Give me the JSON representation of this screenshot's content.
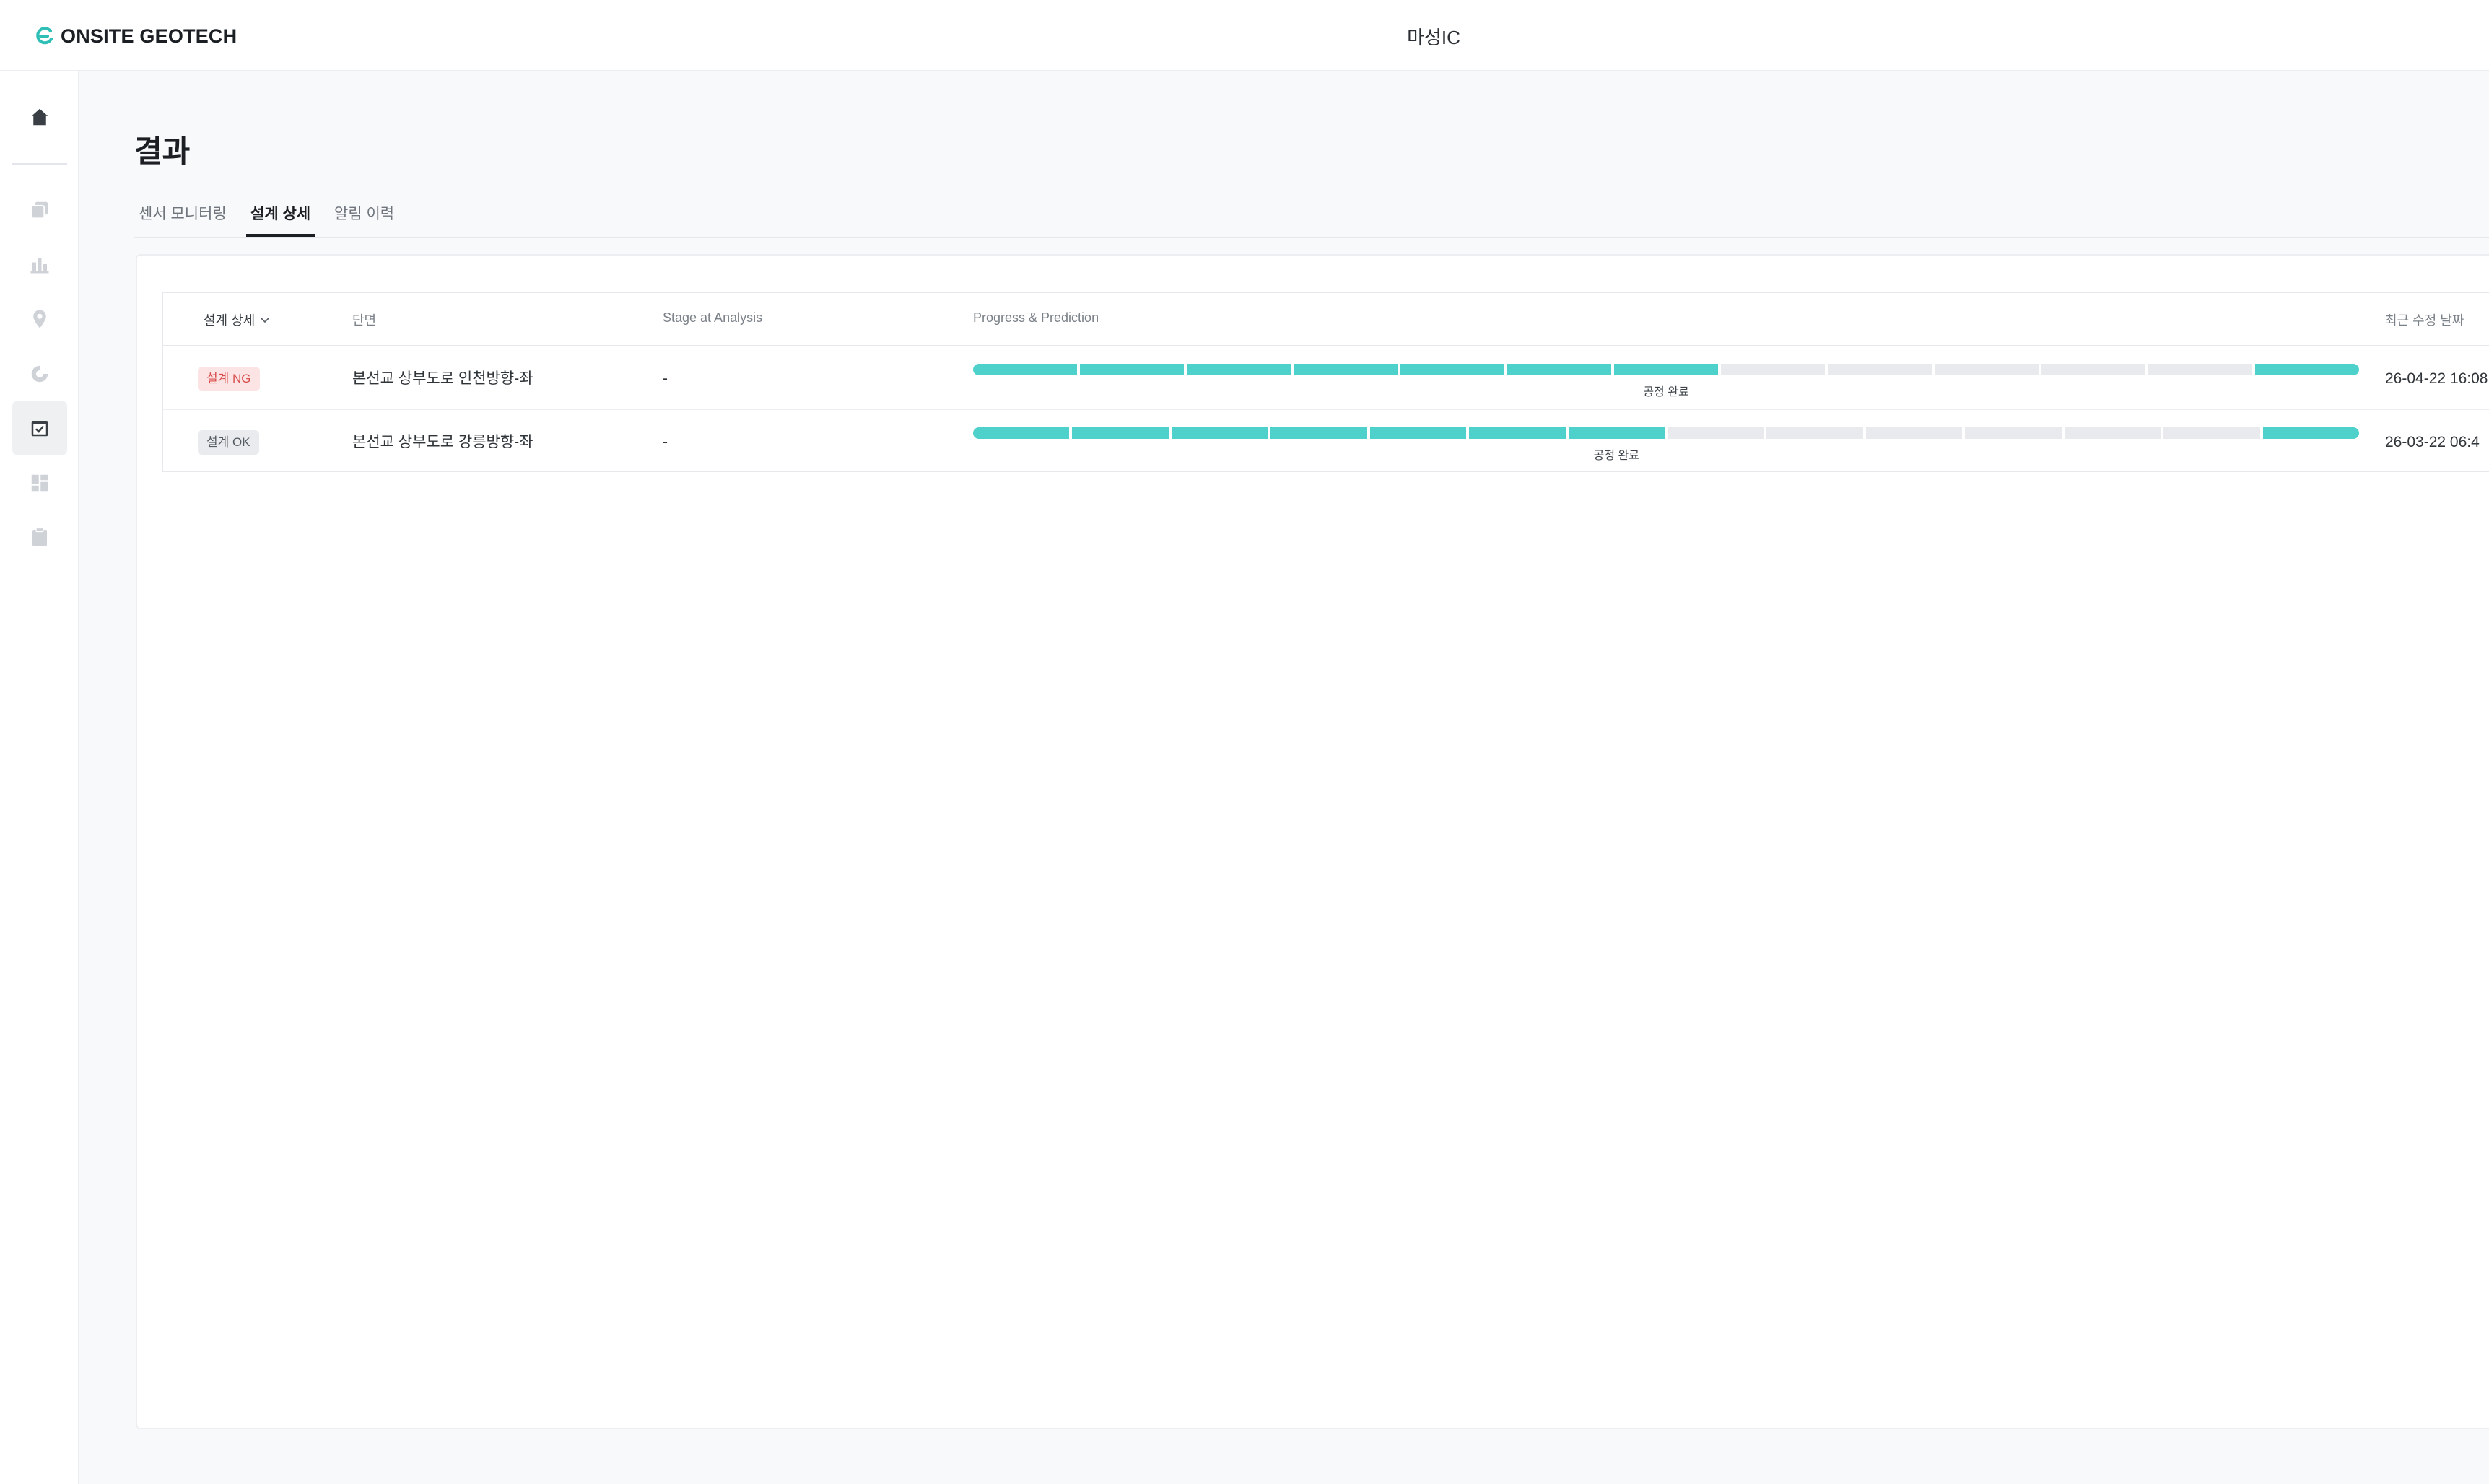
{
  "header": {
    "logo_text": "ONSITE GEOTECH",
    "site_name": "마성IC"
  },
  "page": {
    "title": "결과"
  },
  "tabs": [
    {
      "label": "센서 모니터링",
      "active": false
    },
    {
      "label": "설계 상세",
      "active": true
    },
    {
      "label": "알림 이력",
      "active": false
    }
  ],
  "table": {
    "columns": [
      "설계 상세",
      "단면",
      "Stage at Analysis",
      "Progress & Prediction",
      "최근 수정 날짜"
    ],
    "rows": [
      {
        "status": "설계 NG",
        "section": "본선교 상부도로 인천방향-좌",
        "stage": "-",
        "progress": {
          "label": "공정 완료",
          "total_segments": 13,
          "completed_segments": 7,
          "final_segment_done": true
        },
        "modified": "26-04-22 16:08"
      },
      {
        "status": "설계 OK",
        "section": "본선교 상부도로 강릉방향-좌",
        "stage": "-",
        "progress": {
          "label": "공정 완료",
          "total_segments": 14,
          "completed_segments": 7,
          "final_segment_done": true
        },
        "modified": "26-03-22 06:4"
      }
    ]
  },
  "colors": {
    "accent": "#4fd1cb",
    "ng_text": "#d84b4b",
    "ng_bg": "#fde4e4",
    "ok_bg": "#e9ebee"
  },
  "sidebar_icons": [
    "home-icon",
    "copy-check-icon",
    "bar-chart-icon",
    "location-pin-icon",
    "pie-chart-icon",
    "calendar-check-icon",
    "dashboard-grid-icon",
    "clipboard-icon"
  ]
}
